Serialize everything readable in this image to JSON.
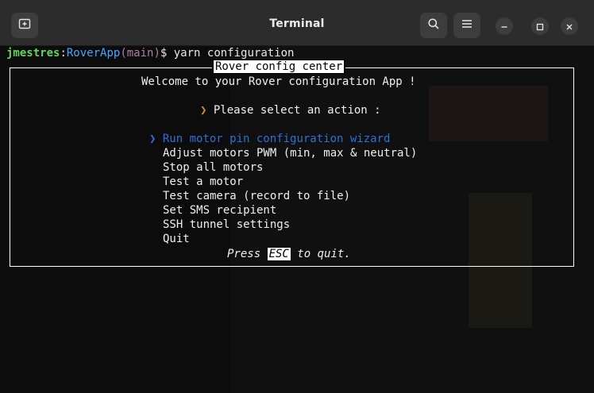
{
  "window": {
    "title": "Terminal",
    "icons": {
      "new_tab": "new-tab-icon",
      "search": "search-icon",
      "menu": "hamburger-menu-icon",
      "minimize": "minimize-icon",
      "maximize": "maximize-icon",
      "close": "close-icon"
    }
  },
  "prompt": {
    "user": "jmestres",
    "sep": ":",
    "path": "RoverApp",
    "branch": "(main)",
    "symbol": "$",
    "command": " yarn configuration"
  },
  "app": {
    "box_title": "Rover config center",
    "welcome": "Welcome to your Rover configuration App !",
    "pointer": "❯",
    "prompt": "Please select an action :",
    "selected_pointer": "❯",
    "actions": [
      "Run motor pin configuration wizard",
      "Adjust motors PWM (min, max & neutral)",
      "Stop all motors",
      "Test a motor",
      "Test camera (record to file)",
      "Set SMS recipient",
      "SSH tunnel settings",
      "Quit"
    ],
    "quit_pre": "Press ",
    "quit_key": "ESC",
    "quit_post": " to quit."
  },
  "colors": {
    "user": "#5fd75f",
    "path": "#4aa3ff",
    "branch": "#ad7fa8",
    "selected": "#2f6fd6",
    "pointer": "#d08a3a"
  }
}
